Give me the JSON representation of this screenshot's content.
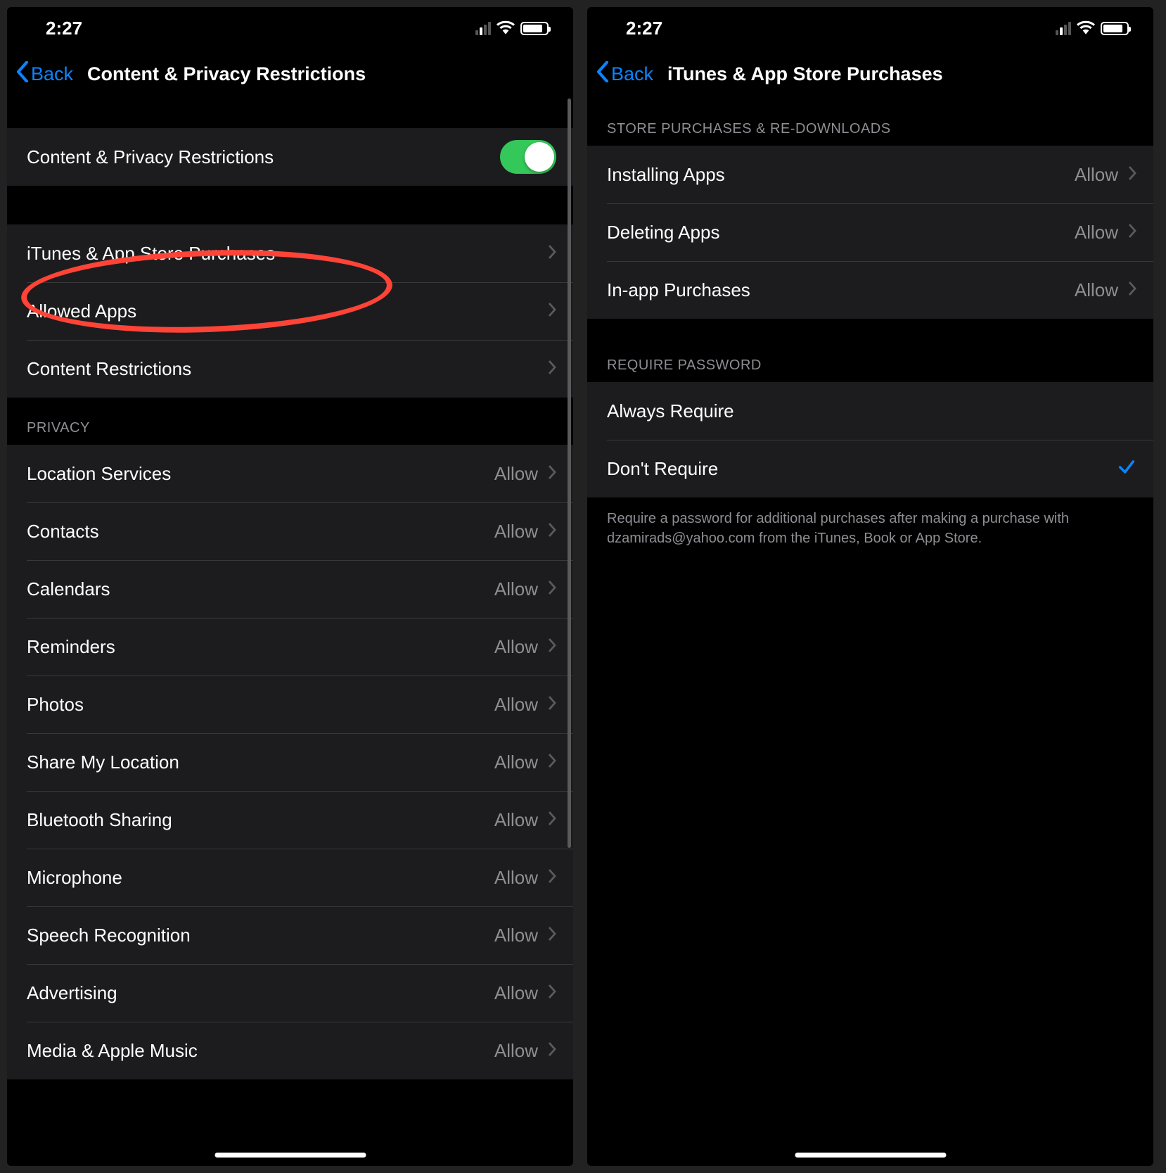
{
  "statusbar": {
    "time": "2:27"
  },
  "left": {
    "back": "Back",
    "title": "Content & Privacy Restrictions",
    "toggleRow": {
      "label": "Content & Privacy Restrictions"
    },
    "navItems": [
      {
        "label": "iTunes & App Store Purchases"
      },
      {
        "label": "Allowed Apps"
      },
      {
        "label": "Content Restrictions"
      }
    ],
    "privacyHeader": "PRIVACY",
    "privacyItems": [
      {
        "label": "Location Services",
        "value": "Allow"
      },
      {
        "label": "Contacts",
        "value": "Allow"
      },
      {
        "label": "Calendars",
        "value": "Allow"
      },
      {
        "label": "Reminders",
        "value": "Allow"
      },
      {
        "label": "Photos",
        "value": "Allow"
      },
      {
        "label": "Share My Location",
        "value": "Allow"
      },
      {
        "label": "Bluetooth Sharing",
        "value": "Allow"
      },
      {
        "label": "Microphone",
        "value": "Allow"
      },
      {
        "label": "Speech Recognition",
        "value": "Allow"
      },
      {
        "label": "Advertising",
        "value": "Allow"
      },
      {
        "label": "Media & Apple Music",
        "value": "Allow"
      }
    ]
  },
  "right": {
    "back": "Back",
    "title": "iTunes & App Store Purchases",
    "storeHeader": "STORE PURCHASES & RE-DOWNLOADS",
    "storeItems": [
      {
        "label": "Installing Apps",
        "value": "Allow"
      },
      {
        "label": "Deleting Apps",
        "value": "Allow"
      },
      {
        "label": "In-app Purchases",
        "value": "Allow"
      }
    ],
    "passwordHeader": "REQUIRE PASSWORD",
    "passwordItems": [
      {
        "label": "Always Require",
        "checked": false
      },
      {
        "label": "Don't Require",
        "checked": true
      }
    ],
    "footer": "Require a password for additional purchases after making a purchase with dzamirads@yahoo.com from the iTunes, Book or App Store."
  }
}
